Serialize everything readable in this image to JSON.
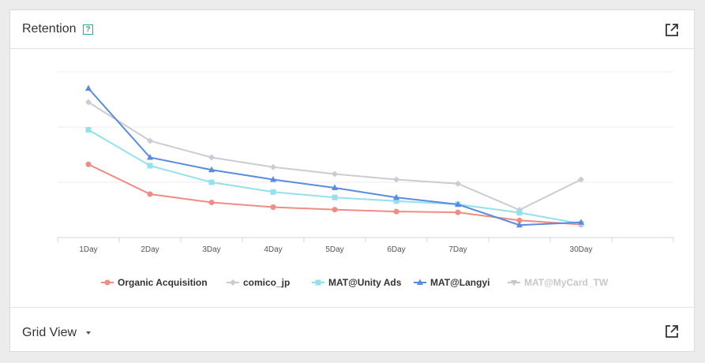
{
  "panel": {
    "title": "Retention",
    "help_icon": "?",
    "footer_title": "Grid View"
  },
  "chart_data": {
    "type": "line",
    "categories": [
      "1Day",
      "2Day",
      "3Day",
      "4Day",
      "5Day",
      "6Day",
      "7Day",
      "",
      "30Day"
    ],
    "legend_position": "bottom",
    "grid": true,
    "series": [
      {
        "name": "Organic Acquisition",
        "color": "#f08c84",
        "marker": "circle",
        "visible": true,
        "values": [
          2.65,
          1.57,
          1.27,
          1.1,
          1.01,
          0.94,
          0.91,
          0.62,
          0.47
        ]
      },
      {
        "name": "comico_jp",
        "color": "#cccbd3",
        "marker": "diamond",
        "visible": true,
        "values": [
          4.9,
          3.5,
          2.9,
          2.55,
          2.3,
          2.1,
          1.95,
          1.0,
          2.1
        ]
      },
      {
        "name": "MAT@Unity Ads",
        "color": "#92e1eb",
        "marker": "square",
        "visible": true,
        "values": [
          3.9,
          2.6,
          2.0,
          1.65,
          1.45,
          1.32,
          1.2,
          0.9,
          0.5
        ]
      },
      {
        "name": "MAT@Langyi",
        "color": "#5b8bde",
        "marker": "triangle",
        "visible": true,
        "values": [
          5.4,
          2.9,
          2.45,
          2.1,
          1.8,
          1.45,
          1.2,
          0.45,
          0.55
        ]
      },
      {
        "name": "MAT@MyCard_TW",
        "color": "#c8c8c8",
        "marker": "triangle-down",
        "visible": false,
        "values": []
      }
    ]
  }
}
